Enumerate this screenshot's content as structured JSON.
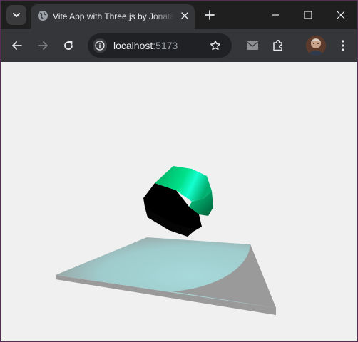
{
  "browser": {
    "tab": {
      "title": "Vite App with Three.js by Jonatan",
      "favicon": "globe-icon",
      "close_icon": "close-icon"
    },
    "tab_search_icon": "chevron-down-icon",
    "new_tab_icon": "plus-icon",
    "window_controls": [
      "minimize-icon",
      "maximize-icon",
      "close-icon"
    ],
    "toolbar": {
      "back_icon": "arrow-left-icon",
      "forward_icon": "arrow-right-icon",
      "reload_icon": "reload-icon",
      "extension_icons": [
        "mail-icon",
        "puzzle-icon"
      ],
      "menu_icon": "kebab-menu-icon"
    },
    "omnibox": {
      "info_icon": "info-icon",
      "host": "localhost",
      "port": ":5173",
      "bookmark_icon": "star-icon"
    }
  },
  "scene": {
    "background": "#f0f0f0",
    "objects": [
      {
        "name": "dodecahedron",
        "color": "#00a060",
        "highlight": "#00ffc0",
        "shadow": "#000000"
      },
      {
        "name": "ground-plane",
        "color": "#9ecdcf",
        "side_color": "#9a9a9a"
      }
    ]
  }
}
